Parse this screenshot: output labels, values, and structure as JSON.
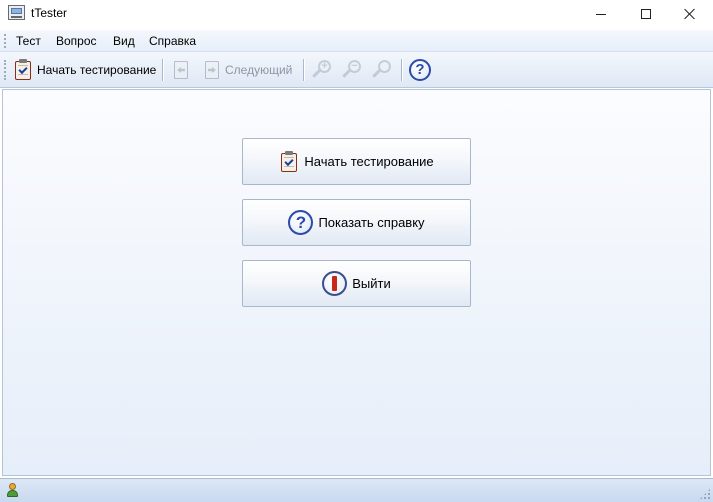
{
  "window": {
    "title": "tTester"
  },
  "menu": {
    "items": [
      "Тест",
      "Вопрос",
      "Вид",
      "Справка"
    ]
  },
  "toolbar": {
    "start_label": "Начать тестирование",
    "next_label": "Следующий",
    "zoom_in_symbol": "+",
    "zoom_out_symbol": "−",
    "help_symbol": "?"
  },
  "main": {
    "buttons": [
      {
        "label": "Начать тестирование",
        "icon": "clipboard-check-icon"
      },
      {
        "label": "Показать справку",
        "icon": "help-icon"
      },
      {
        "label": "Выйти",
        "icon": "exit-icon"
      }
    ]
  },
  "colors": {
    "accent": "#2c4ba8",
    "exit_red": "#c8281a",
    "background_top": "#fbfcfe",
    "background_bottom": "#e6eef9"
  }
}
